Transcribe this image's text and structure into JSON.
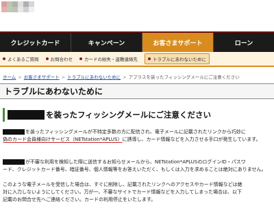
{
  "logo": {
    "colors": [
      "#d9a0a0",
      "#c7c0b8",
      "#a8b8a0",
      "#e0e0e0",
      "#b0b0b0",
      "#d6d6d6",
      "#e8b0b0",
      "#b8d0b0",
      "#c0c0c0",
      "#e8e8e8",
      "#d0d0d0",
      "#f0f0f0"
    ]
  },
  "mainnav": {
    "items": [
      {
        "label": "クレジットカード"
      },
      {
        "label": "キャンペーン"
      },
      {
        "label": "お客さまサポート"
      },
      {
        "label": "ローン"
      }
    ]
  },
  "subnav": {
    "items": [
      {
        "label": "よくあるご質問"
      },
      {
        "label": "お問合わせ"
      },
      {
        "label": "カードの紛失・盗難連絡先"
      },
      {
        "label": "トラブルにあわないために"
      }
    ]
  },
  "breadcrumb": {
    "items": [
      "ホーム",
      "お客さまサポート",
      "トラブルにあわないために",
      "アプラスを装ったフィッシングメールにご注意ください"
    ],
    "separator": ">"
  },
  "page_title": "トラブルにあわないために",
  "section_heading": "を装ったフィッシングメールにご注意ください",
  "paragraph1": {
    "line1": "を装ったフィッシングメールが不特定多数の方に配信され、電子メールに記載されたリンクから巧妙に",
    "line2_highlight": "偽のカード会員様向けサービス（NETstation*APLUS）",
    "line2_rest": "に誘導し、カード情報などを入力させる手口が発生しています。"
  },
  "paragraph2": {
    "line1": "が不審な利用を検知した際に送信するお知らせメールから、NETstation*APLUSのログインID・パスワ",
    "line2": "ード、クレジットカード番号、暗証番号、個人情報等をお答えいただく、もしくは入力を求めることは絶対にありません。"
  },
  "paragraph3": {
    "line1": "このような電子メールを受信した場合は、すぐに削除し、記載されたリンクへのアクセスやカード情報などは絶",
    "line2": "対に入力しないようにしてください。万が一、不審なサイトでカード情報などを入力してしまった場合は、以下",
    "line3": "記載のお問合せ先へご連絡ください。カードの利用停止をいたします。"
  }
}
